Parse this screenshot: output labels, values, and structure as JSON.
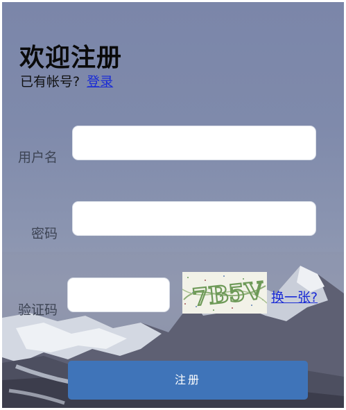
{
  "title": "欢迎注册",
  "subtitle": {
    "text": "已有帐号?",
    "login_link": "登录"
  },
  "form": {
    "username_label": "用户名",
    "username_value": "",
    "password_label": "密码",
    "password_value": "",
    "captcha_label": "验证码",
    "captcha_value": "",
    "captcha_image_text": "7B5V",
    "refresh_link": "换一张? ",
    "submit_label": "注册"
  },
  "colors": {
    "accent": "#3f74b9",
    "link": "#1a2bd6"
  }
}
